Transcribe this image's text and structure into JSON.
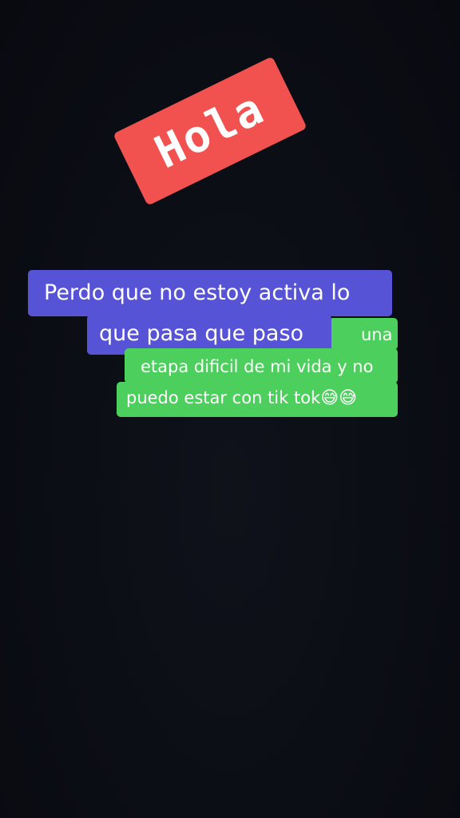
{
  "sticker": {
    "text": "Hola"
  },
  "caption": {
    "line1": "Perdo que no estoy activa lo",
    "line2": "que pasa que paso",
    "line3": "una",
    "line4": "etapa dificil de mi vida y no",
    "line5": "puedo estar con tik tok",
    "line5_emoji": "😅😅"
  },
  "colors": {
    "background": "#0b0d14",
    "sticker_bg": "#f2524f",
    "purple_bg": "#5653d6",
    "green_bg": "#4ccf5c",
    "text": "#ffffff"
  }
}
